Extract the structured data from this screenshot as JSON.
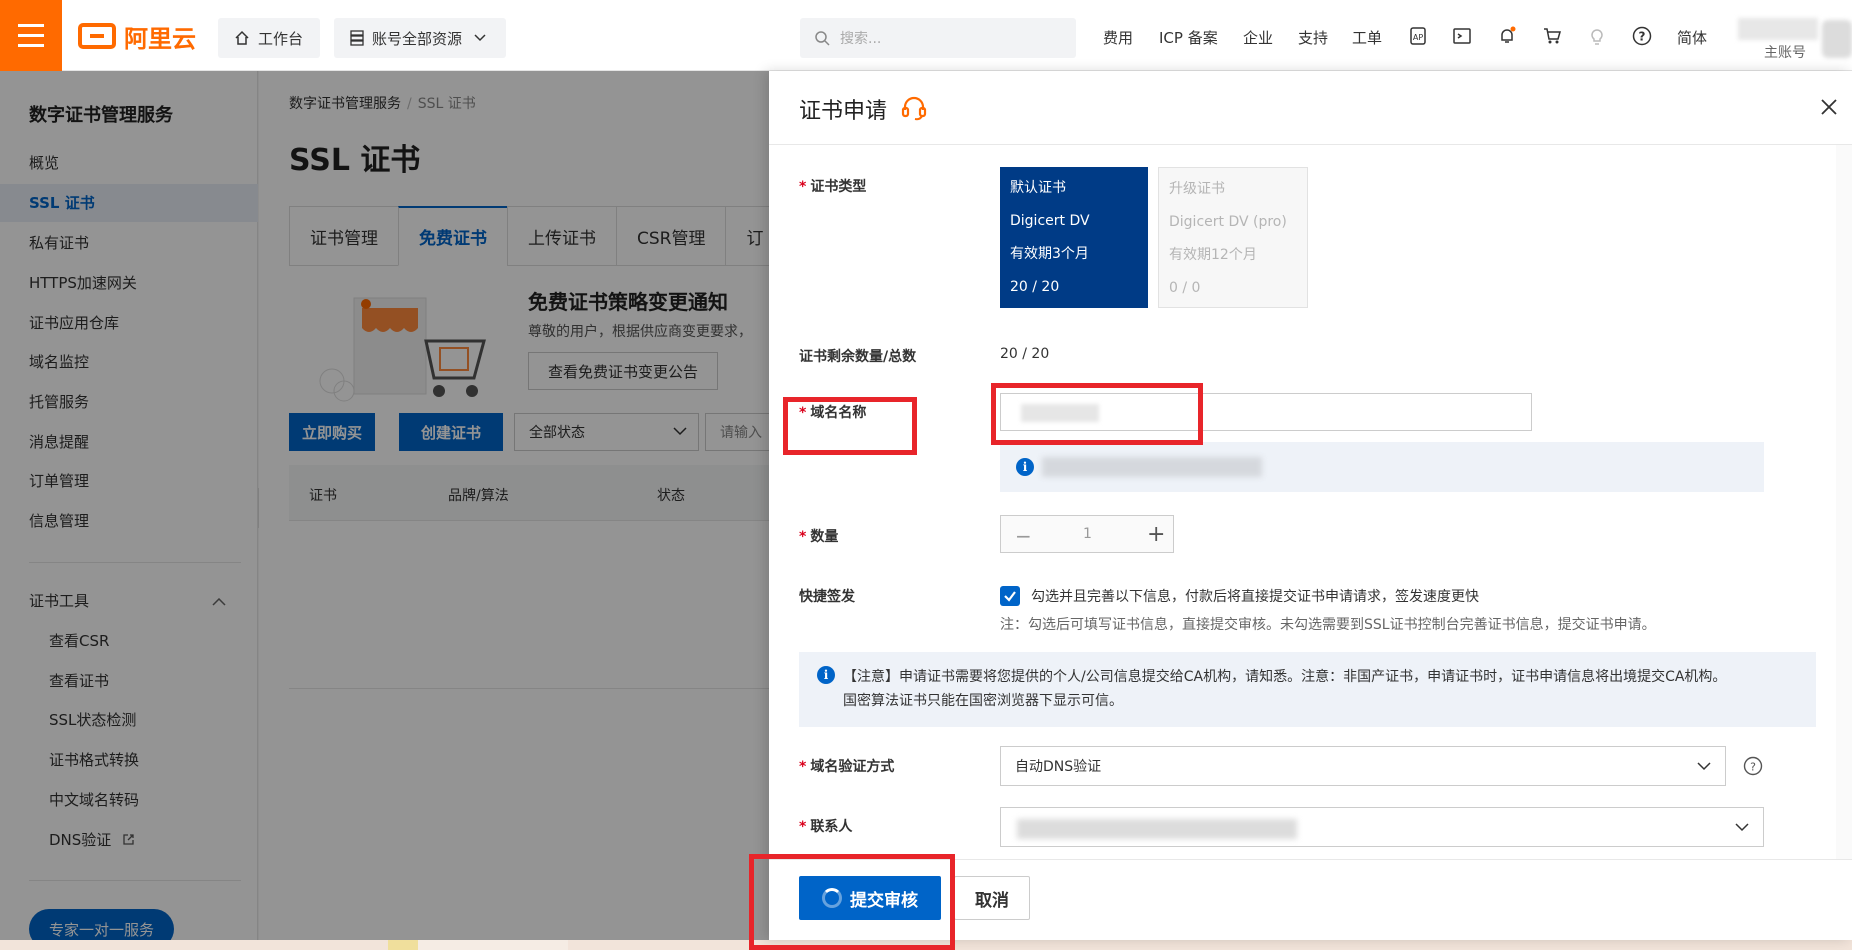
{
  "topbar": {
    "brand": "阿里云",
    "workbench": "工作台",
    "resources": "账号全部资源",
    "search_placeholder": "搜索...",
    "links": [
      "费用",
      "ICP 备案",
      "企业",
      "支持",
      "工单"
    ],
    "lang": "简体",
    "account": "主账号"
  },
  "sidebar": {
    "title": "数字证书管理服务",
    "items": [
      {
        "label": "概览"
      },
      {
        "label": "SSL 证书"
      },
      {
        "label": "私有证书"
      },
      {
        "label": "HTTPS加速网关"
      },
      {
        "label": "证书应用仓库"
      },
      {
        "label": "域名监控"
      },
      {
        "label": "托管服务"
      },
      {
        "label": "消息提醒"
      },
      {
        "label": "订单管理"
      },
      {
        "label": "信息管理"
      }
    ],
    "tools_title": "证书工具",
    "tools": [
      {
        "label": "查看CSR"
      },
      {
        "label": "查看证书"
      },
      {
        "label": "SSL状态检测"
      },
      {
        "label": "证书格式转换"
      },
      {
        "label": "中文域名转码"
      },
      {
        "label": "DNS验证"
      }
    ],
    "expert_button": "专家一对一服务"
  },
  "main": {
    "breadcrumb": [
      "数字证书管理服务",
      "SSL 证书"
    ],
    "title": "SSL 证书",
    "tabs": [
      "证书管理",
      "免费证书",
      "上传证书",
      "CSR管理",
      "订"
    ],
    "notice_title": "免费证书策略变更通知",
    "notice_text": "尊敬的用户，根据供应商变更要求，",
    "notice_button": "查看免费证书变更公告",
    "buy_button": "立即购买",
    "create_button": "创建证书",
    "status_select": "全部状态",
    "search_input": "请输入",
    "table_headers": [
      "证书",
      "品牌/算法",
      "状态"
    ]
  },
  "drawer": {
    "title": "证书申请",
    "labels": {
      "cert_type": "证书类型",
      "remaining": "证书剩余数量/总数",
      "domain": "域名名称",
      "quantity": "数量",
      "quick_issue": "快捷签发",
      "verify_method": "域名验证方式",
      "contact": "联系人"
    },
    "type_default": {
      "title": "默认证书",
      "brand": "Digicert DV",
      "validity": "有效期3个月",
      "count": "20 / 20"
    },
    "type_upgrade": {
      "title": "升级证书",
      "brand": "Digicert DV (pro)",
      "validity": "有效期12个月",
      "count": "0 / 0"
    },
    "remaining_value": "20 / 20",
    "quantity_value": "1",
    "quick_issue_label": "勾选并且完善以下信息，付款后将直接提交证书申请请求，签发速度更快",
    "quick_issue_note": "注：勾选后可填写证书信息，直接提交审核。未勾选需要到SSL证书控制台完善证书信息，提交证书申请。",
    "notice_line1": "【注意】申请证书需要将您提供的个人/公司信息提交给CA机构，请知悉。注意：非国产证书，申请证书时，证书申请信息将出境提交CA机构。",
    "notice_line2": "国密算法证书只能在国密浏览器下显示可信。",
    "verify_value": "自动DNS验证",
    "submit_button": "提交审核",
    "cancel_button": "取消"
  },
  "colors": {
    "accent": "#0064c8",
    "brand": "#ff6a00",
    "annotation": "#e8252a"
  }
}
